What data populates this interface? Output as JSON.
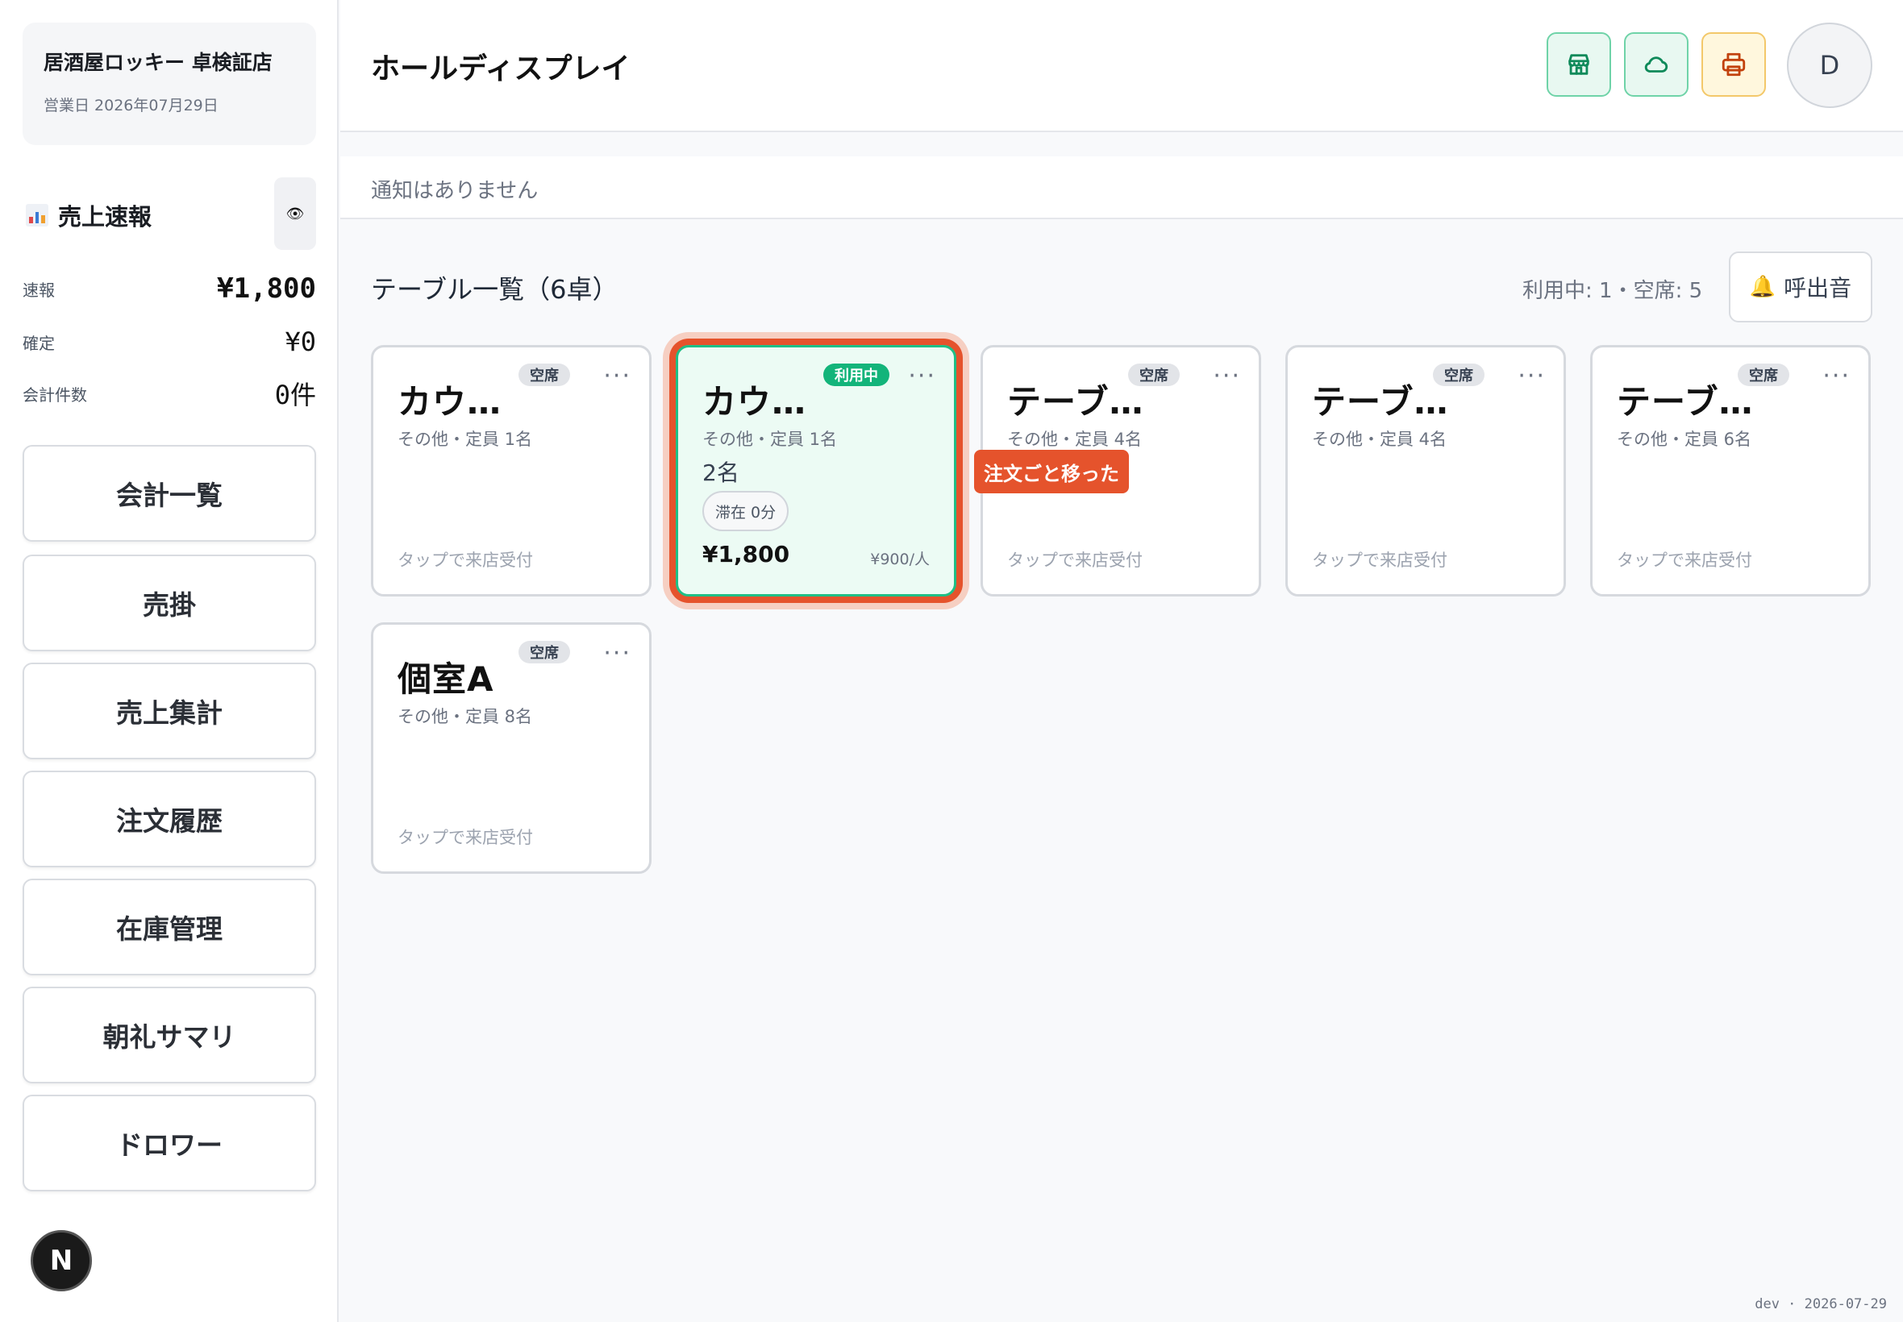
{
  "sidebar": {
    "store_name": "居酒屋ロッキー 卓検証店",
    "business_date": "営業日 2026年07月29日",
    "sales_title": "売上速報",
    "stats": [
      {
        "label": "速報",
        "value": "¥1,800"
      },
      {
        "label": "確定",
        "value": "¥0"
      },
      {
        "label": "会計件数",
        "value": "0件"
      }
    ],
    "nav": [
      "会計一覧",
      "売掛",
      "売上集計",
      "注文履歴",
      "在庫管理",
      "朝礼サマリ",
      "ドロワー"
    ],
    "dev_badge": "N"
  },
  "header": {
    "title": "ホールディスプレイ",
    "avatar": "D"
  },
  "notice": "通知はありません",
  "tables": {
    "title": "テーブル一覧（6卓）",
    "counts": "利用中: 1・空席: 5",
    "bell_label": "呼出音",
    "items": [
      {
        "name": "カウ…",
        "status": "空席",
        "meta": "その他・定員 1名",
        "hint": "タップで来店受付"
      },
      {
        "name": "カウ…",
        "status": "利用中",
        "meta": "その他・定員 1名",
        "guests": "2名",
        "stay": "滞在 0分",
        "price": "¥1,800",
        "per": "¥900/人"
      },
      {
        "name": "テーブ…",
        "status": "空席",
        "meta": "その他・定員 4名",
        "hint": "タップで来店受付"
      },
      {
        "name": "テーブ…",
        "status": "空席",
        "meta": "その他・定員 4名",
        "hint": "タップで来店受付"
      },
      {
        "name": "テーブ…",
        "status": "空席",
        "meta": "その他・定員 6名",
        "hint": "タップで来店受付"
      },
      {
        "name": "個室A",
        "status": "空席",
        "meta": "その他・定員 8名",
        "hint": "タップで来店受付"
      }
    ],
    "toast": "注文ごと移った"
  },
  "footer": "dev · 2026-07-29",
  "colors": {
    "accent": "#13b47a",
    "alert": "#e5532c"
  }
}
